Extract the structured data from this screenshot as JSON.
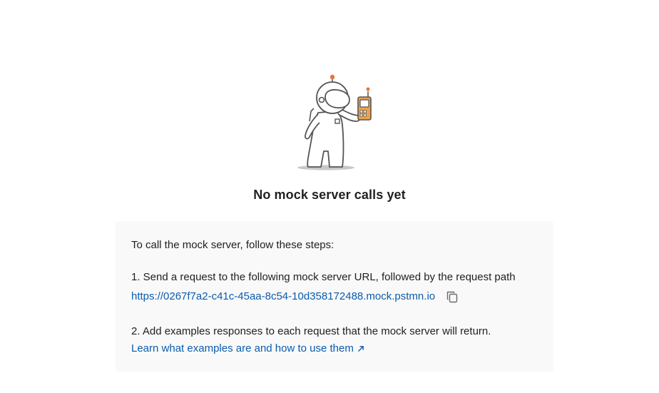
{
  "empty_state": {
    "title": "No mock server calls yet",
    "illustration": "astronaut-holding-walkie-talkie"
  },
  "instructions": {
    "intro": "To call the mock server, follow these steps:",
    "step1_text": "1. Send a request to the following mock server URL, followed by the request path",
    "mock_url": "https://0267f7a2-c41c-45aa-8c54-10d358172488.mock.pstmn.io",
    "copy_icon": "copy-icon",
    "step2_text": "2. Add examples responses to each request that the mock server will return.",
    "learn_link": "Learn what examples are and how to use them",
    "learn_icon": "external-arrow-icon"
  },
  "colors": {
    "link": "#0b5cad",
    "panel_bg": "#f9f9f9",
    "accent_orange": "#f0a04b",
    "text": "#212121"
  }
}
